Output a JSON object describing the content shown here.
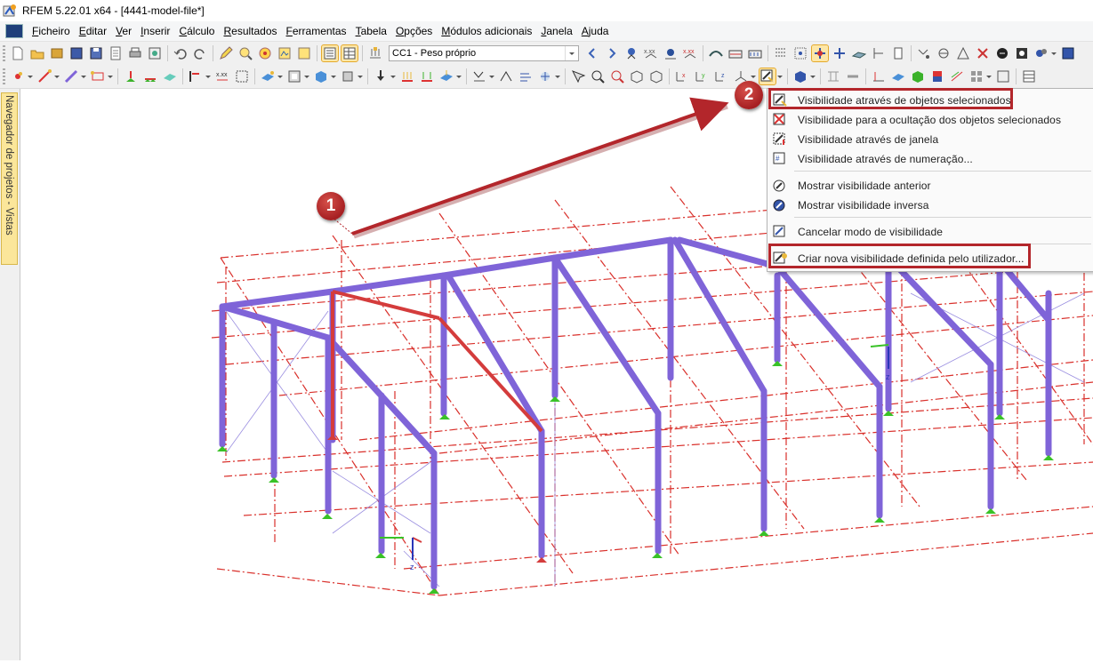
{
  "window": {
    "title": "RFEM 5.22.01 x64 - [4441-model-file*]"
  },
  "menu": [
    "Ficheiro",
    "Editar",
    "Ver",
    "Inserir",
    "Cálculo",
    "Resultados",
    "Ferramentas",
    "Tabela",
    "Opções",
    "Módulos adicionais",
    "Janela",
    "Ajuda"
  ],
  "toolbar": {
    "load_case": "CC1 - Peso próprio"
  },
  "navigator": {
    "tab_label": "Navegador de projetos - Vistas"
  },
  "context_menu": {
    "items": [
      "Visibilidade através de objetos selecionados",
      "Visibilidade para a ocultação dos objetos selecionados",
      "Visibilidade através de janela",
      "Visibilidade através de numeração...",
      "Mostrar visibilidade anterior",
      "Mostrar visibilidade inversa",
      "Cancelar modo de visibilidade",
      "Criar nova visibilidade definida pelo utilizador..."
    ]
  },
  "annotations": {
    "step1": "1",
    "step2": "2"
  },
  "model": {
    "axis_label_1": "z",
    "axis_label_2": "z"
  },
  "colors": {
    "member": "#7f64d8",
    "selected_member": "#d43c3c",
    "grid_line": "#d9302b",
    "support": "#39c227",
    "annotation": "#b3262b"
  }
}
